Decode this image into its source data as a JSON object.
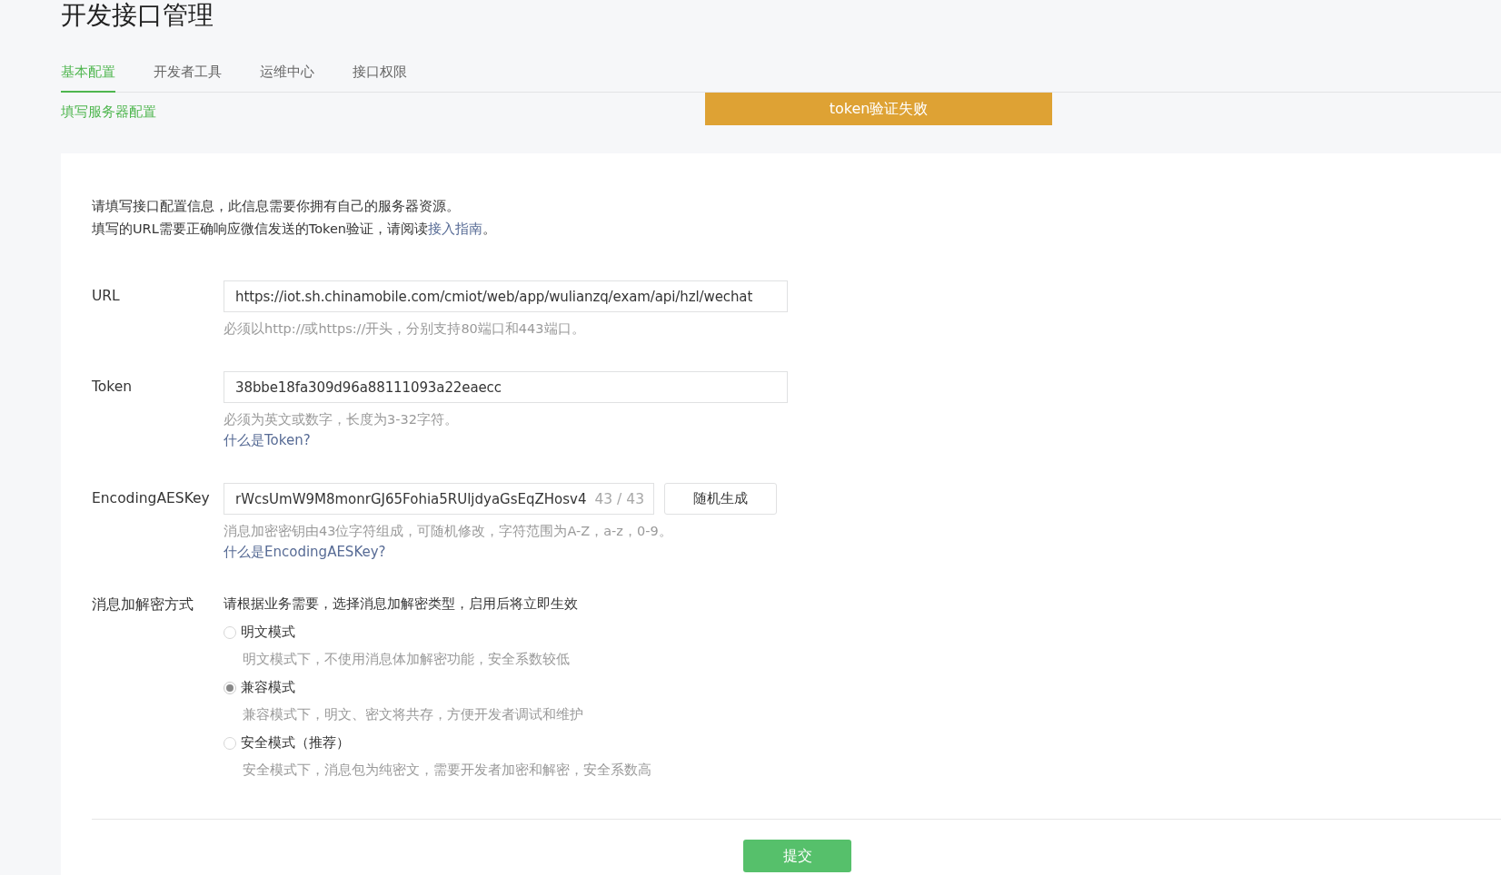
{
  "page_title": "开发接口管理",
  "tabs": [
    {
      "label": "基本配置",
      "selected": true
    },
    {
      "label": "开发者工具",
      "selected": false
    },
    {
      "label": "运维中心",
      "selected": false
    },
    {
      "label": "接口权限",
      "selected": false
    }
  ],
  "section_link": "填写服务器配置",
  "toast": "token验证失败",
  "intro": {
    "line_1": "请填写接口配置信息，此信息需要你拥有自己的服务器资源。",
    "line_2": "填写的URL需要正确响应微信发送的Token验证，请阅读",
    "link": "接入指南",
    "line_2_end": "。"
  },
  "fields": [
    {
      "label": "URL",
      "value": "https://iot.sh.chinamobile.com/cmiot/web/app/wulianzq/exam/api/hzl/wechat",
      "hint": "必须以http://或https://开头，分别支持80端口和443端口。"
    },
    {
      "label": "Token",
      "value": "38bbe18fa309d96a88111093a22eaecc",
      "hint": "必须为英文或数字，长度为3-32字符。",
      "help_link": "什么是Token?"
    },
    {
      "label": "EncodingAESKey",
      "value": "rWcsUmW9M8monrGJ65Fohia5RUljdyaGsEqZHosv4",
      "counter": "43 / 43",
      "button": "随机生成",
      "hint": "消息加密密钥由43位字符组成，可随机修改，字符范围为A-Z，a-z，0-9。",
      "help_link": "什么是EncodingAESKey?"
    }
  ],
  "encryption": {
    "label": "消息加解密方式",
    "intro": "请根据业务需要，选择消息加解密类型，启用后将立即生效",
    "options": [
      {
        "label": "明文模式",
        "description": "明文模式下，不使用消息体加解密功能，安全系数较低",
        "selected": false
      },
      {
        "label": "兼容模式",
        "description": "兼容模式下，明文、密文将共存，方便开发者调试和维护",
        "selected": true
      },
      {
        "label": "安全模式（推荐）",
        "description": "安全模式下，消息包为纯密文，需要开发者加密和解密，安全系数高",
        "selected": false
      }
    ]
  },
  "submit": "提交"
}
